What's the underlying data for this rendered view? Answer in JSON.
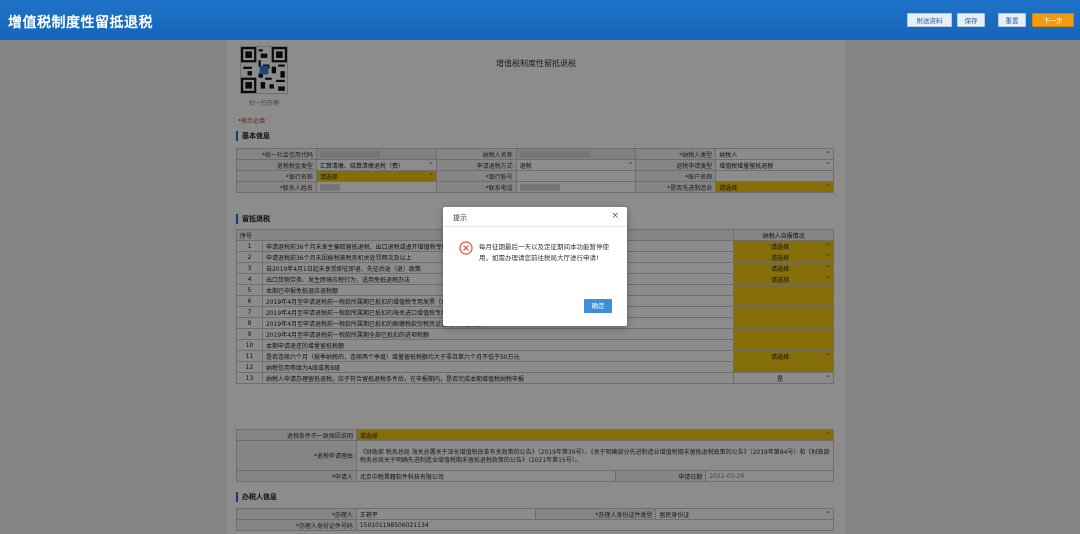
{
  "header": {
    "title": "增值税制度性留抵退税",
    "buttons": {
      "attach": "附送资料",
      "save": "保存",
      "reset": "重置",
      "next": "下一步"
    }
  },
  "form": {
    "qr_caption": "扫一扫办理",
    "doc_title": "增值税制度性留抵退税",
    "required_note": "*表示必填",
    "sections": {
      "basic": "基本信息",
      "refund": "留抵退税",
      "agent": "办税人信息"
    },
    "basic": {
      "credit_code_label": "*统一社会信用代码",
      "taxpayer_name_label": "纳税人名称",
      "taxpayer_type_label": "*纳税人类型",
      "taxpayer_type_value": "纳税人",
      "refund_type_label": "退税税金类型",
      "refund_type_value": "汇算清缴、结算清缴退税（费）",
      "apply_method_label": "申请退税方式",
      "apply_method_value": "退税",
      "apply_category_label": "退税申请类型",
      "apply_category_value": "增值税增量留抵退税",
      "bank_label": "*银行名称",
      "bank_value": "请选择",
      "account_label": "*银行账号",
      "account_name_label": "*账户名称",
      "contact_label": "*联系人姓名",
      "phone_label": "*联系电话",
      "advanced_label": "*是否先进制造业",
      "advanced_value": "请选择"
    },
    "list": {
      "col_no": "序号",
      "col_answer": "纳税人自报情况",
      "rows": [
        {
          "no": "1",
          "text": "申请退税前36个月未发生骗取留抵退税、出口退税或虚开增值税专用发票情形",
          "answer": "请选择"
        },
        {
          "no": "2",
          "text": "申请退税前36个月未因偷税被税务机关处罚两次及以上",
          "answer": "请选择"
        },
        {
          "no": "3",
          "text": "自2019年4月1日起未享受即征即退、先征后返（退）政策",
          "answer": "请选择"
        },
        {
          "no": "4",
          "text": "出口货物劳务、发生跨境应税行为，适用免抵退税办法",
          "answer": "请选择"
        },
        {
          "no": "5",
          "text": "本期已申报免抵退应退税额",
          "answer": ""
        },
        {
          "no": "6",
          "text": "2019年4月至申请退税前一税款所属期已抵扣的增值税专用发票（含",
          "answer": ""
        },
        {
          "no": "7",
          "text": "2019年4月至申请退税前一税款所属期已抵扣的海关进口增值税专用缴款书注明的增值税额",
          "answer": ""
        },
        {
          "no": "8",
          "text": "2019年4月至申请退税前一税款所属期已抵扣的解缴税款完税凭证注明的增值税额",
          "answer": ""
        },
        {
          "no": "9",
          "text": "2019年4月至申请退税前一税款所属期全部已抵扣的进项税额",
          "answer": ""
        },
        {
          "no": "10",
          "text": "本期申请退还的增量留抵税额",
          "answer": ""
        },
        {
          "no": "11",
          "text": "是否连续六个月（按季纳税的，连续两个季度）增量留抵税额均大于零且第六个月不低于50万元",
          "answer": "请选择"
        },
        {
          "no": "12",
          "text": "纳税信用等级为A级或者B级",
          "answer": ""
        },
        {
          "no": "13",
          "text": "纳税人申请办理留抵退税，应于符合留抵退税条件后，在申报期内，是否完成本期增值税纳税申报",
          "answer": "是"
        }
      ]
    },
    "reason_label": "退税条件不一致原因说明",
    "reason_value": "请选择",
    "basis_label": "*退税申请理由",
    "basis_text": "《财政部 税务总局 海关总署关于深化增值税改革有关政策的公告》（2019年第39号）、《关于明确部分先进制造业增值税期末留抵退税政策的公告》（2019年第84号）和《财政部 税务总局关于明确先进制造业增值税期末留抵退税政策的公告》（2021年第15号）。",
    "applicant_label": "*申请人",
    "applicant_value": "北京中税晋籍软件科技有限公司",
    "apply_date_label": "申请日期",
    "apply_date_value": "2022-03-29",
    "agent": {
      "name_label": "*办理人",
      "name_value": "王艳平",
      "id_type_label": "*办理人身份证件类型",
      "id_type_value": "居民身份证",
      "id_no_label": "*办理人身份证件号码",
      "id_no_value": "150101198506021134"
    }
  },
  "modal": {
    "title": "提示",
    "close": "×",
    "message": "每月征期最后一天以及定征期间本功能暂停使用，如需办理请您前往税局大厅进行申请!",
    "ok": "确定"
  },
  "colors": {
    "header": "#1f74c9",
    "highlight": "#f2c80f",
    "next_button": "#f39a13",
    "ok_button": "#3f8fd8",
    "error_icon": "#e44c3f"
  }
}
